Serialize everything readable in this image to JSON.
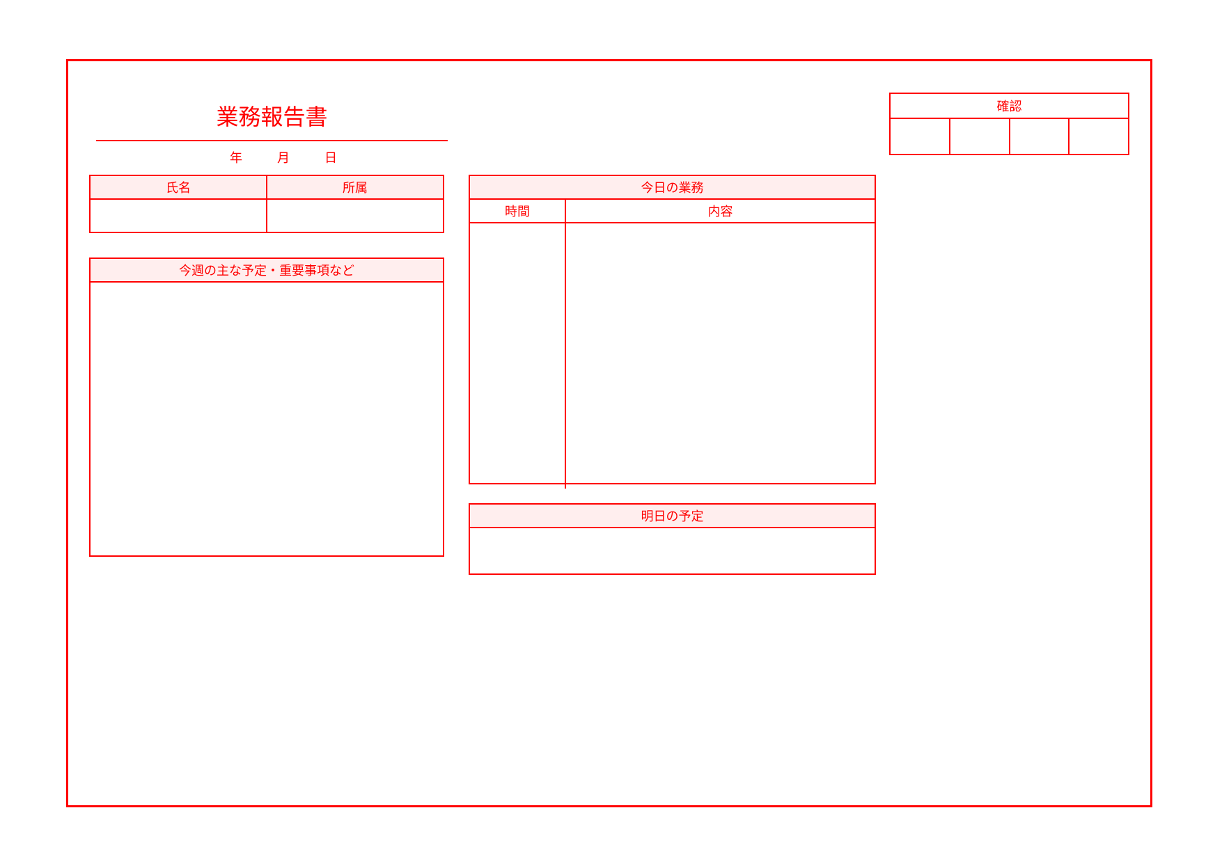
{
  "title": "業務報告書",
  "date": {
    "year": "年",
    "month": "月",
    "day": "日"
  },
  "stamp": {
    "header": "確認",
    "cells": [
      "",
      "",
      "",
      ""
    ]
  },
  "identity": {
    "headers": {
      "name": "氏名",
      "dept": "所属"
    },
    "values": {
      "name": "",
      "dept": ""
    }
  },
  "weekly": {
    "header": "今週の主な予定・重要事項など",
    "body": ""
  },
  "today": {
    "header": "今日の業務",
    "columns": {
      "time": "時間",
      "content": "内容"
    },
    "body_time": "",
    "body_content": ""
  },
  "tomorrow": {
    "header": "明日の予定",
    "body": ""
  }
}
